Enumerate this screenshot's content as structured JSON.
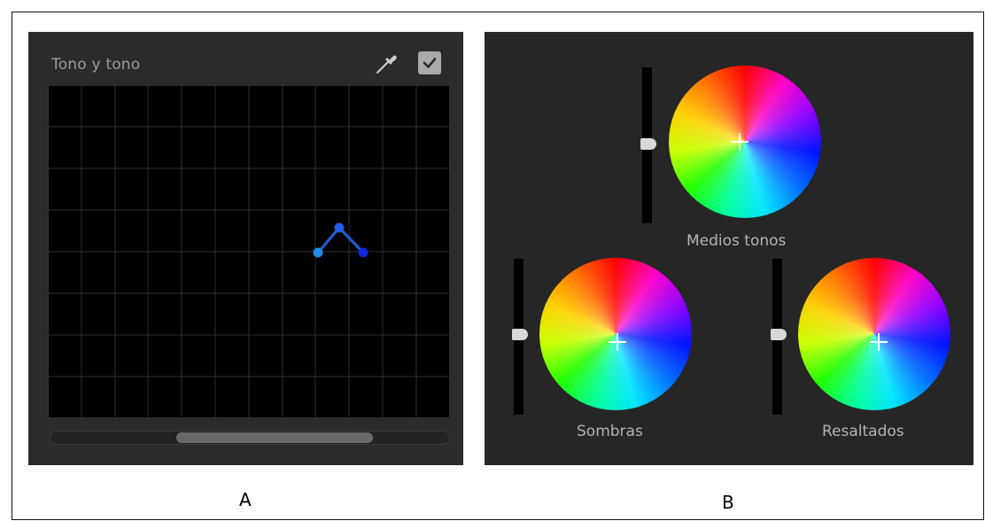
{
  "panel_a": {
    "title": "Tono y tono",
    "caption": "A",
    "icons": {
      "eyedropper": "eyedropper-icon",
      "checkbox": "checkbox-checked-icon"
    },
    "checkbox_checked": true
  },
  "panel_b": {
    "caption": "B",
    "wheels": {
      "midtones": {
        "label": "Medios tonos"
      },
      "shadows": {
        "label": "Sombras"
      },
      "highlights": {
        "label": "Resaltados"
      }
    }
  },
  "colors": {
    "panel_bg": "#2b2b2b",
    "curve_point": "#1e6fd8",
    "grid": "#2e2e2e"
  }
}
